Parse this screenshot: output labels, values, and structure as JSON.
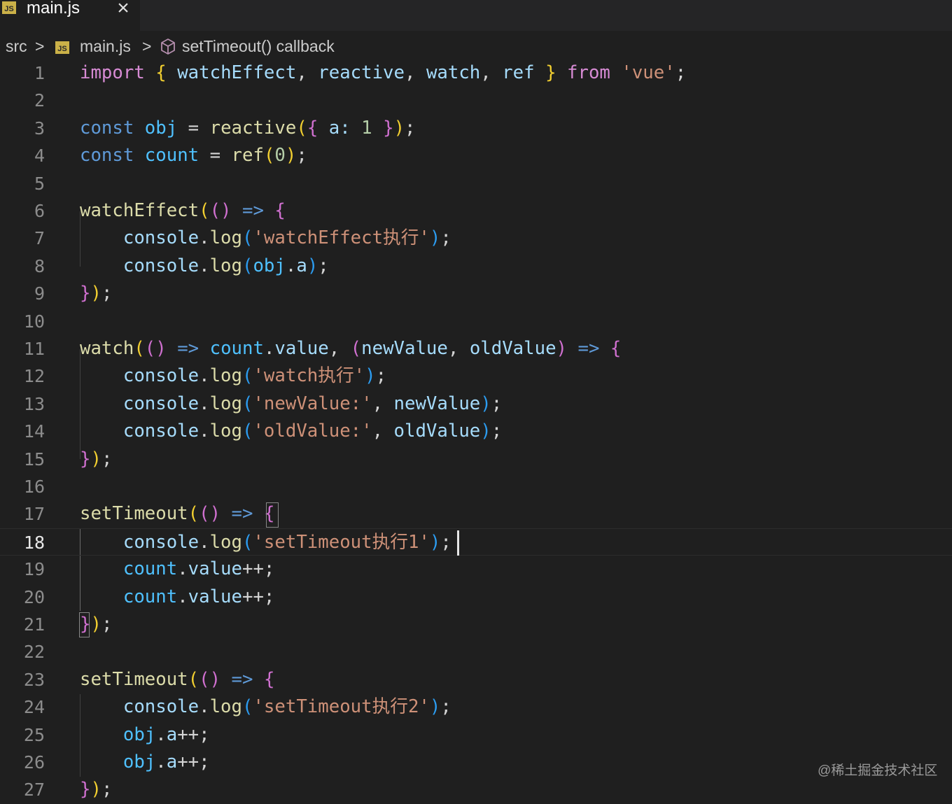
{
  "tab": {
    "badge": "JS",
    "label": "main.js",
    "close_icon": "×"
  },
  "breadcrumb": {
    "folder": "src",
    "file_badge": "JS",
    "file": "main.js",
    "symbol": "setTimeout() callback",
    "separator": ">"
  },
  "editor": {
    "current_line": 18,
    "line_numbers": [
      "1",
      "2",
      "3",
      "4",
      "5",
      "6",
      "7",
      "8",
      "9",
      "10",
      "11",
      "12",
      "13",
      "14",
      "15",
      "16",
      "17",
      "18",
      "19",
      "20",
      "21",
      "22",
      "23",
      "24",
      "25",
      "26",
      "27"
    ],
    "lines": [
      [
        [
          "import",
          "kw"
        ],
        [
          " ",
          "op"
        ],
        [
          "{",
          "p1"
        ],
        [
          " ",
          "op"
        ],
        [
          "watchEffect",
          "var"
        ],
        [
          ", ",
          "op"
        ],
        [
          "reactive",
          "var"
        ],
        [
          ", ",
          "op"
        ],
        [
          "watch",
          "var"
        ],
        [
          ", ",
          "op"
        ],
        [
          "ref",
          "var"
        ],
        [
          " ",
          "op"
        ],
        [
          "}",
          "p1"
        ],
        [
          " ",
          "op"
        ],
        [
          "from",
          "kw"
        ],
        [
          " ",
          "op"
        ],
        [
          "'vue'",
          "str"
        ],
        [
          ";",
          "op"
        ]
      ],
      [],
      [
        [
          "const",
          "kw2"
        ],
        [
          " ",
          "op"
        ],
        [
          "obj",
          "obj"
        ],
        [
          " = ",
          "op"
        ],
        [
          "reactive",
          "fn"
        ],
        [
          "(",
          "p1"
        ],
        [
          "{",
          "p2"
        ],
        [
          " a: ",
          "var"
        ],
        [
          "1",
          "num"
        ],
        [
          " ",
          "op"
        ],
        [
          "}",
          "p2"
        ],
        [
          ")",
          "p1"
        ],
        [
          ";",
          "op"
        ]
      ],
      [
        [
          "const",
          "kw2"
        ],
        [
          " ",
          "op"
        ],
        [
          "count",
          "obj"
        ],
        [
          " = ",
          "op"
        ],
        [
          "ref",
          "fn"
        ],
        [
          "(",
          "p1"
        ],
        [
          "0",
          "num"
        ],
        [
          ")",
          "p1"
        ],
        [
          ";",
          "op"
        ]
      ],
      [],
      [
        [
          "watchEffect",
          "fn"
        ],
        [
          "(",
          "p1"
        ],
        [
          "()",
          "p2"
        ],
        [
          " ",
          "op"
        ],
        [
          "=>",
          "arrow"
        ],
        [
          " ",
          "op"
        ],
        [
          "{",
          "p2"
        ]
      ],
      [
        [
          "    console",
          "var"
        ],
        [
          ".",
          "op"
        ],
        [
          "log",
          "fn"
        ],
        [
          "(",
          "p3"
        ],
        [
          "'watchEffect执行'",
          "str"
        ],
        [
          ")",
          "p3"
        ],
        [
          ";",
          "op"
        ]
      ],
      [
        [
          "    console",
          "var"
        ],
        [
          ".",
          "op"
        ],
        [
          "log",
          "fn"
        ],
        [
          "(",
          "p3"
        ],
        [
          "obj",
          "obj"
        ],
        [
          ".",
          "op"
        ],
        [
          "a",
          "var"
        ],
        [
          ")",
          "p3"
        ],
        [
          ";",
          "op"
        ]
      ],
      [
        [
          "}",
          "p2"
        ],
        [
          ")",
          "p1"
        ],
        [
          ";",
          "op"
        ]
      ],
      [],
      [
        [
          "watch",
          "fn"
        ],
        [
          "(",
          "p1"
        ],
        [
          "()",
          "p2"
        ],
        [
          " ",
          "op"
        ],
        [
          "=>",
          "arrow"
        ],
        [
          " ",
          "op"
        ],
        [
          "count",
          "obj"
        ],
        [
          ".",
          "op"
        ],
        [
          "value",
          "var"
        ],
        [
          ", ",
          "op"
        ],
        [
          "(",
          "p2"
        ],
        [
          "newValue",
          "var"
        ],
        [
          ", ",
          "op"
        ],
        [
          "oldValue",
          "var"
        ],
        [
          ")",
          "p2"
        ],
        [
          " ",
          "op"
        ],
        [
          "=>",
          "arrow"
        ],
        [
          " ",
          "op"
        ],
        [
          "{",
          "p2"
        ]
      ],
      [
        [
          "    console",
          "var"
        ],
        [
          ".",
          "op"
        ],
        [
          "log",
          "fn"
        ],
        [
          "(",
          "p3"
        ],
        [
          "'watch执行'",
          "str"
        ],
        [
          ")",
          "p3"
        ],
        [
          ";",
          "op"
        ]
      ],
      [
        [
          "    console",
          "var"
        ],
        [
          ".",
          "op"
        ],
        [
          "log",
          "fn"
        ],
        [
          "(",
          "p3"
        ],
        [
          "'newValue:'",
          "str"
        ],
        [
          ", ",
          "op"
        ],
        [
          "newValue",
          "var"
        ],
        [
          ")",
          "p3"
        ],
        [
          ";",
          "op"
        ]
      ],
      [
        [
          "    console",
          "var"
        ],
        [
          ".",
          "op"
        ],
        [
          "log",
          "fn"
        ],
        [
          "(",
          "p3"
        ],
        [
          "'oldValue:'",
          "str"
        ],
        [
          ", ",
          "op"
        ],
        [
          "oldValue",
          "var"
        ],
        [
          ")",
          "p3"
        ],
        [
          ";",
          "op"
        ]
      ],
      [
        [
          "}",
          "p2"
        ],
        [
          ")",
          "p1"
        ],
        [
          ";",
          "op"
        ]
      ],
      [],
      [
        [
          "setTimeout",
          "fn"
        ],
        [
          "(",
          "p1"
        ],
        [
          "()",
          "p2"
        ],
        [
          " ",
          "op"
        ],
        [
          "=>",
          "arrow"
        ],
        [
          " ",
          "op"
        ],
        [
          "{",
          "p2"
        ]
      ],
      [
        [
          "    console",
          "var"
        ],
        [
          ".",
          "op"
        ],
        [
          "log",
          "fn"
        ],
        [
          "(",
          "p3"
        ],
        [
          "'setTimeout执行1'",
          "str"
        ],
        [
          ")",
          "p3"
        ],
        [
          ";",
          "op"
        ]
      ],
      [
        [
          "    count",
          "obj"
        ],
        [
          ".",
          "op"
        ],
        [
          "value",
          "var"
        ],
        [
          "++;",
          "op"
        ]
      ],
      [
        [
          "    count",
          "obj"
        ],
        [
          ".",
          "op"
        ],
        [
          "value",
          "var"
        ],
        [
          "++;",
          "op"
        ]
      ],
      [
        [
          "}",
          "p2"
        ],
        [
          ")",
          "p1"
        ],
        [
          ";",
          "op"
        ]
      ],
      [],
      [
        [
          "setTimeout",
          "fn"
        ],
        [
          "(",
          "p1"
        ],
        [
          "()",
          "p2"
        ],
        [
          " ",
          "op"
        ],
        [
          "=>",
          "arrow"
        ],
        [
          " ",
          "op"
        ],
        [
          "{",
          "p2"
        ]
      ],
      [
        [
          "    console",
          "var"
        ],
        [
          ".",
          "op"
        ],
        [
          "log",
          "fn"
        ],
        [
          "(",
          "p3"
        ],
        [
          "'setTimeout执行2'",
          "str"
        ],
        [
          ")",
          "p3"
        ],
        [
          ";",
          "op"
        ]
      ],
      [
        [
          "    obj",
          "obj"
        ],
        [
          ".",
          "op"
        ],
        [
          "a",
          "var"
        ],
        [
          "++;",
          "op"
        ]
      ],
      [
        [
          "    obj",
          "obj"
        ],
        [
          ".",
          "op"
        ],
        [
          "a",
          "var"
        ],
        [
          "++;",
          "op"
        ]
      ],
      [
        [
          "}",
          "p2"
        ],
        [
          ")",
          "p1"
        ],
        [
          ";",
          "op"
        ]
      ]
    ]
  },
  "watermark": "@稀土掘金技术社区"
}
